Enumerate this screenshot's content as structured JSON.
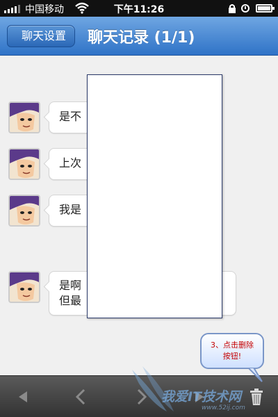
{
  "status_bar": {
    "carrier": "中国移动",
    "time": "下午11:26"
  },
  "nav": {
    "back_label": "聊天设置",
    "title": "聊天记录 (1/1)"
  },
  "messages": [
    {
      "text": "是不"
    },
    {
      "text": "上次"
    },
    {
      "text": "我是"
    },
    {
      "text_line1": "是啊",
      "text_line2": "但最"
    }
  ],
  "callout": {
    "line1": "3、点击删除",
    "line2": "按钮!"
  },
  "toolbar": {
    "icons": [
      "play-left-icon",
      "chevron-left-icon",
      "chevron-right-icon",
      "play-right-icon",
      "trash-icon"
    ]
  },
  "watermark": {
    "text": "我爱IT技术网",
    "url": "www.52ij.com"
  },
  "colors": {
    "nav_bar": "#3f82cf",
    "toolbar": "#444444",
    "callout_text": "#c40000"
  }
}
